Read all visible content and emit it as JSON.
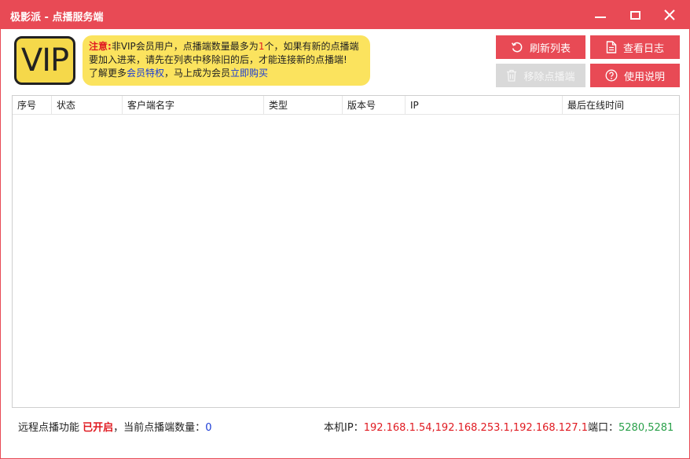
{
  "window": {
    "title": "极影派 - 点播服务端"
  },
  "vip_badge": {
    "text": "VIP"
  },
  "notice": {
    "label": "注意:",
    "part1": "非VIP会员用户，点播端数量最多为",
    "limit": "1",
    "part2": "个，如果有新的点播端要加入进来，请先在列表中移除旧的后，才能连接新的点播端!",
    "part3": "了解更多",
    "link1": "会员特权",
    "part4": "，马上成为会员",
    "link2": "立即购买"
  },
  "toolbar": {
    "refresh_label": "刷新列表",
    "log_label": "查看日志",
    "remove_label": "移除点播端",
    "help_label": "使用说明"
  },
  "table": {
    "columns": [
      "序号",
      "状态",
      "客户端名字",
      "类型",
      "版本号",
      "IP",
      "最后在线时间"
    ],
    "rows": []
  },
  "status": {
    "remote_label": "远程点播功能",
    "remote_state": "已开启",
    "count_label": "，当前点播端数量：",
    "count": "0",
    "ip_label": "本机IP：",
    "ip_value": "192.168.1.54,192.168.253.1,192.168.127.1",
    "port_label": "端口：",
    "port_value": "5280,5281"
  },
  "colors": {
    "accent": "#e84a55",
    "notice_bg": "#fbe35e",
    "vip_bg": "#f5d84a",
    "link": "#1a3bd6",
    "warning": "#e01b22",
    "port": "#2aa04a"
  }
}
